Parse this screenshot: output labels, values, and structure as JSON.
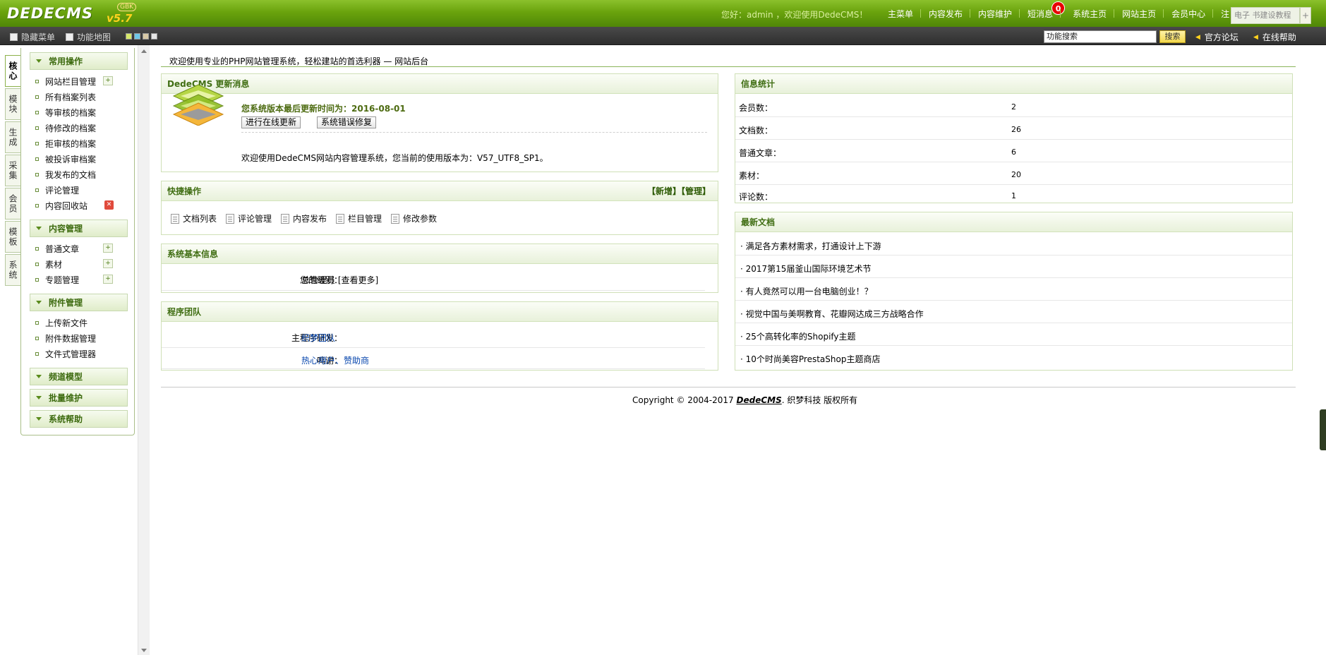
{
  "header": {
    "logo_text": "DEDECMS",
    "logo_version": "v5.7",
    "logo_badge": "GBK",
    "greeting": "您好：admin ，欢迎使用DedeCMS！",
    "nav": [
      {
        "label": "主菜单"
      },
      {
        "label": "内容发布"
      },
      {
        "label": "内容维护"
      },
      {
        "label": "短消息",
        "badge": "0"
      },
      {
        "label": "系统主页"
      },
      {
        "label": "网站主页"
      },
      {
        "label": "会员中心"
      },
      {
        "label": "注"
      }
    ],
    "corner_text": "电子 书建设教程",
    "corner_plus": "+"
  },
  "toolbar": {
    "hide_menu": "隐藏菜单",
    "function_map": "功能地图",
    "search_value": "功能搜索",
    "search_button": "搜索",
    "forum_link": "官方论坛",
    "help_link": "在线帮助",
    "colors": [
      "#d6e86a",
      "#6ec6e8",
      "#d8c9a6",
      "#e6e6e6"
    ]
  },
  "module_tabs": [
    "核心",
    "模块",
    "生成",
    "采集",
    "会员",
    "模板",
    "系统"
  ],
  "menu": {
    "groups": [
      {
        "title": "常用操作",
        "items": [
          "网站栏目管理",
          "所有档案列表",
          "等审核的档案",
          "待修改的档案",
          "拒审核的档案",
          "被投诉审档案",
          "我发布的文档",
          "评论管理",
          "内容回收站"
        ]
      },
      {
        "title": "内容管理",
        "items": [
          "普通文章",
          "素材",
          "专题管理"
        ]
      },
      {
        "title": "附件管理",
        "items": [
          "上传新文件",
          "附件数据管理",
          "文件式管理器"
        ]
      },
      {
        "title": "频道模型",
        "items": []
      },
      {
        "title": "批量维护",
        "items": []
      },
      {
        "title": "系统帮助",
        "items": []
      }
    ]
  },
  "main": {
    "welcome": "欢迎使用专业的PHP网站管理系统，轻松建站的首选利器 — 网站后台",
    "update_panel": {
      "title": "DedeCMS 更新消息",
      "last_update": "您系统版本最后更新时间为：2016-08-01",
      "btn_online_update": "进行在线更新",
      "btn_fix": "系统错误修复",
      "version_text": "欢迎使用DedeCMS网站内容管理系统，您当前的使用版本为：V57_UTF8_SP1。"
    },
    "quick_panel": {
      "title": "快捷操作",
      "head_links": "【新增】【管理】",
      "items": [
        "文档列表",
        "评论管理",
        "内容发布",
        "栏目管理",
        "修改参数"
      ]
    },
    "sysinfo_panel": {
      "title": "系统基本信息",
      "label": "您的级别：",
      "value": "总管理员 [查看更多]"
    },
    "team_panel": {
      "title": "程序团队",
      "dev_label": "主程序研发：",
      "dev_value": "织梦团队",
      "thanks_label": "鸣谢：",
      "thanks_value": "热心用户、赞助商"
    },
    "stats_panel": {
      "title": "信息统计",
      "rows": [
        {
          "label": "会员数：",
          "value": "2"
        },
        {
          "label": "文档数：",
          "value": "26"
        },
        {
          "label": "普通文章：",
          "value": "6"
        },
        {
          "label": "素材：",
          "value": "20"
        },
        {
          "label": "评论数：",
          "value": "1"
        }
      ]
    },
    "news_panel": {
      "title": "最新文档",
      "items": [
        "· 满足各方素材需求，打通设计上下游",
        "· 2017第15届釜山国际环境艺术节",
        "· 有人竟然可以用一台电脑创业！？",
        "· 视觉中国与美啊教育、花瓣网达成三方战略合作",
        "· 25个高转化率的Shopify主题",
        "· 10个时尚美容PrestaShop主题商店"
      ]
    }
  },
  "footer": {
    "prefix": "Copyright © 2004-2017",
    "brand": "DedeCMS",
    "suffix": ". 织梦科技 版权所有"
  }
}
